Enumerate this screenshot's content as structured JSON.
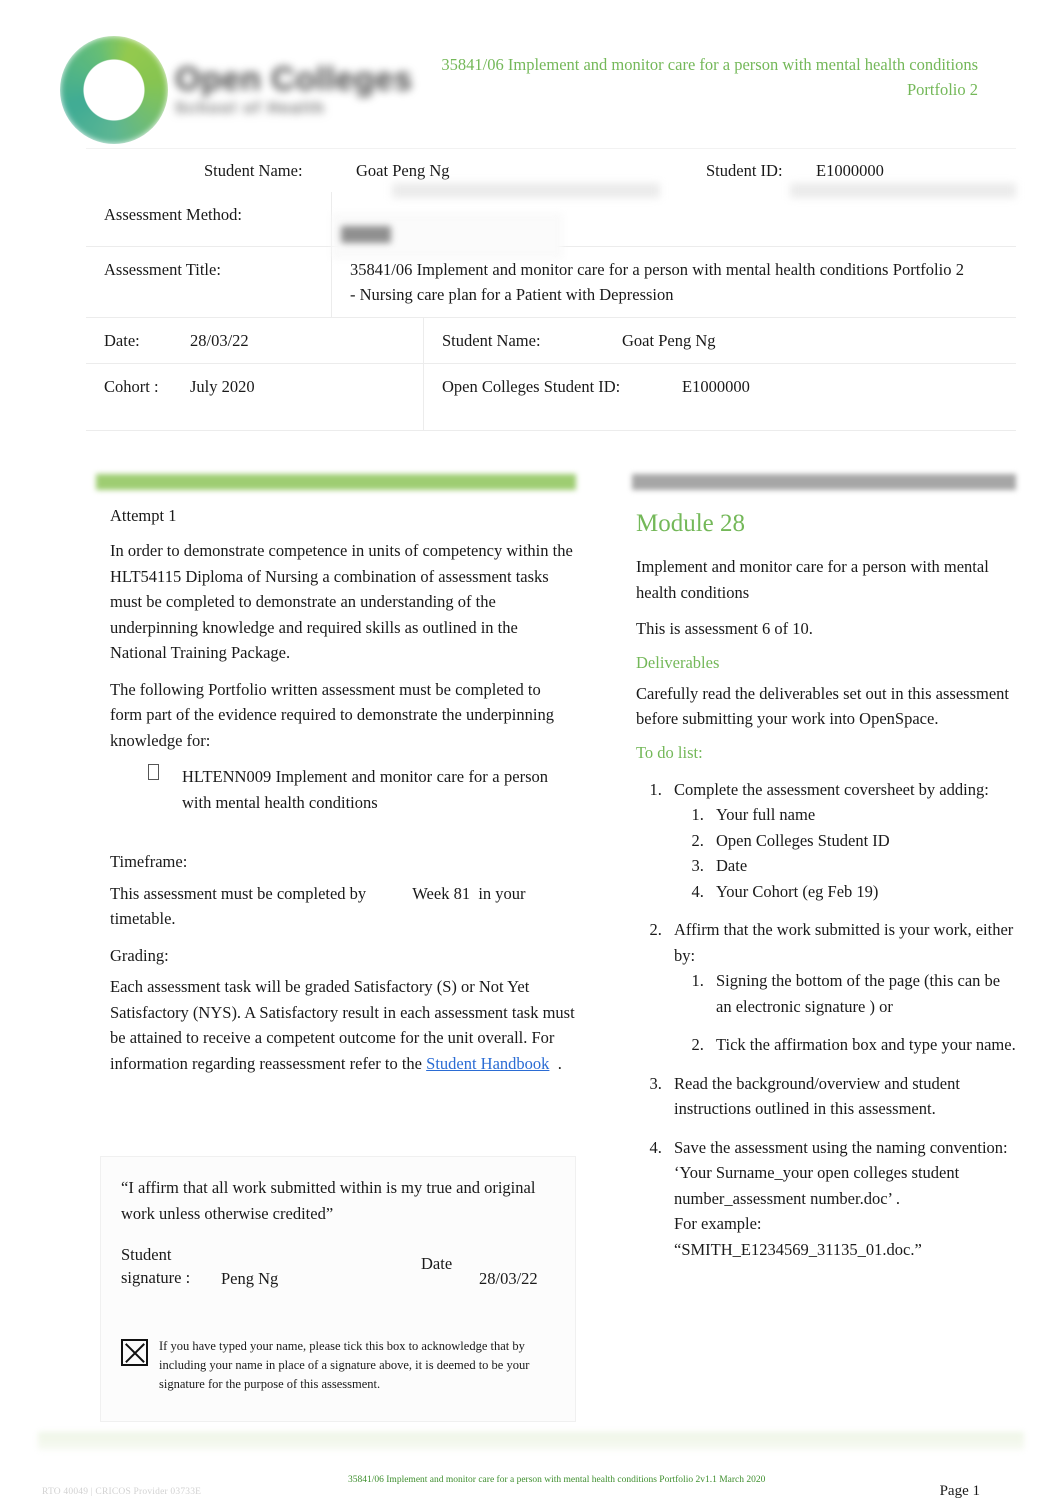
{
  "header": {
    "logo": {
      "line1": "Open Colleges",
      "line2": "School of Health"
    },
    "doc_title": "35841/06 Implement and monitor care for a person with mental health conditions Portfolio 2"
  },
  "cover": {
    "student_name_label": "Student Name:",
    "student_name_value": "Goat Peng Ng",
    "student_id_label": "Student ID:",
    "student_id_value": "E1000000",
    "assessment_method_label": "Assessment Method:",
    "assessment_method_value": "",
    "assessment_title_label": "Assessment Title:",
    "assessment_title_value": "35841/06 Implement and monitor care for a person with mental health conditions Portfolio 2 - Nursing care plan for a Patient with Depression",
    "date_label": "Date:",
    "date_value": "28/03/22",
    "student_name2_label": "Student Name:",
    "student_name2_value": "Goat Peng Ng",
    "cohort_label": "Cohort :",
    "cohort_value": "July 2020",
    "oc_student_id_label": "Open Colleges Student ID:",
    "oc_student_id_value": "E1000000"
  },
  "left": {
    "attempt": "Attempt 1",
    "para1": "In order to demonstrate competence in units of competency within the    HLT54115 Diploma of Nursing   a combination of assessment tasks must be completed to demonstrate an understanding of the underpinning knowledge and required skills as outlined in the National Training Package.",
    "para2": "The following Portfolio written assessment must be completed to form part of the evidence required to demonstrate the underpinning knowledge for:",
    "bullet1": "HLTENN009  Implement  and  monitor  care for a person with mental health conditions",
    "timeframe_heading": "Timeframe:",
    "timeframe_text_a": "This assessment must be completed by",
    "timeframe_week": "Week 81",
    "timeframe_text_b": "in your timetable.",
    "grading_heading": "Grading:",
    "grading_text_a": "Each assessment task will be graded Satisfactory (S) or Not Yet Satisfactory (NYS).      A Satisfactory result in each assessment task must be attained to receive a competent outcome for the unit overall. For information regarding reassessment refer to the",
    "grading_link": "Student Handbook",
    "grading_text_b": "."
  },
  "affirmation": {
    "quote": "“I affirm that all work submitted within is my true and original work unless otherwise credited”",
    "signature_label": "Student signature :",
    "signature_value": "Peng Ng",
    "date_label": "Date",
    "date_value": "28/03/22",
    "checkbox_checked": true,
    "checkbox_text": "If you have typed your name, please tick this box to acknowledge that by including your name in place of a signature above, it is deemed to be your signature for the purpose of this assessment."
  },
  "right": {
    "module_heading": "Module 28",
    "module_subtitle": "Implement and monitor care for a person with mental health conditions",
    "assessment_count": "This is assessment 6 of 10.",
    "deliverables_heading": "Deliverables",
    "deliverables_text": "Carefully read the deliverables set out in this assessment before submitting your work into OpenSpace.",
    "todo_heading": "To do list:",
    "todo": [
      {
        "text": "Complete the assessment coversheet by adding:",
        "sub": [
          "Your full name",
          "Open Colleges Student ID",
          "Date",
          "Your Cohort (eg Feb 19)"
        ],
        "spaced": false
      },
      {
        "text": "Affirm that the work submitted is your work, either by:",
        "sub": [
          "Signing the bottom of the page (this can be an electronic signature   ) or",
          "Tick the affirmation box and type your name."
        ],
        "spaced": true
      },
      {
        "text": "Read the background/overview and student instructions outlined in this assessment.",
        "sub": [],
        "spaced": false
      },
      {
        "text": "Save the assessment using the naming convention:",
        "sub": [],
        "spaced": false,
        "extra": [
          "‘Your Surname_your open colleges student number_assessment number.doc’ .",
          "For example:",
          "“SMITH_E1234569_31135_01.doc.”"
        ]
      }
    ]
  },
  "footer": {
    "left": "RTO 40049   |  CRICOS Provider 03733E",
    "center": "35841/06 Implement and monitor care for a person with mental health conditions Portfolio 2v1.1 March 2020",
    "right": "Page 1"
  },
  "colors": {
    "brand_green": "#74b859",
    "bar_green": "#9ecd72",
    "bar_grey": "#a6a6a6",
    "link_blue": "#2b6cd4",
    "footer_green": "#3f8f2f"
  }
}
